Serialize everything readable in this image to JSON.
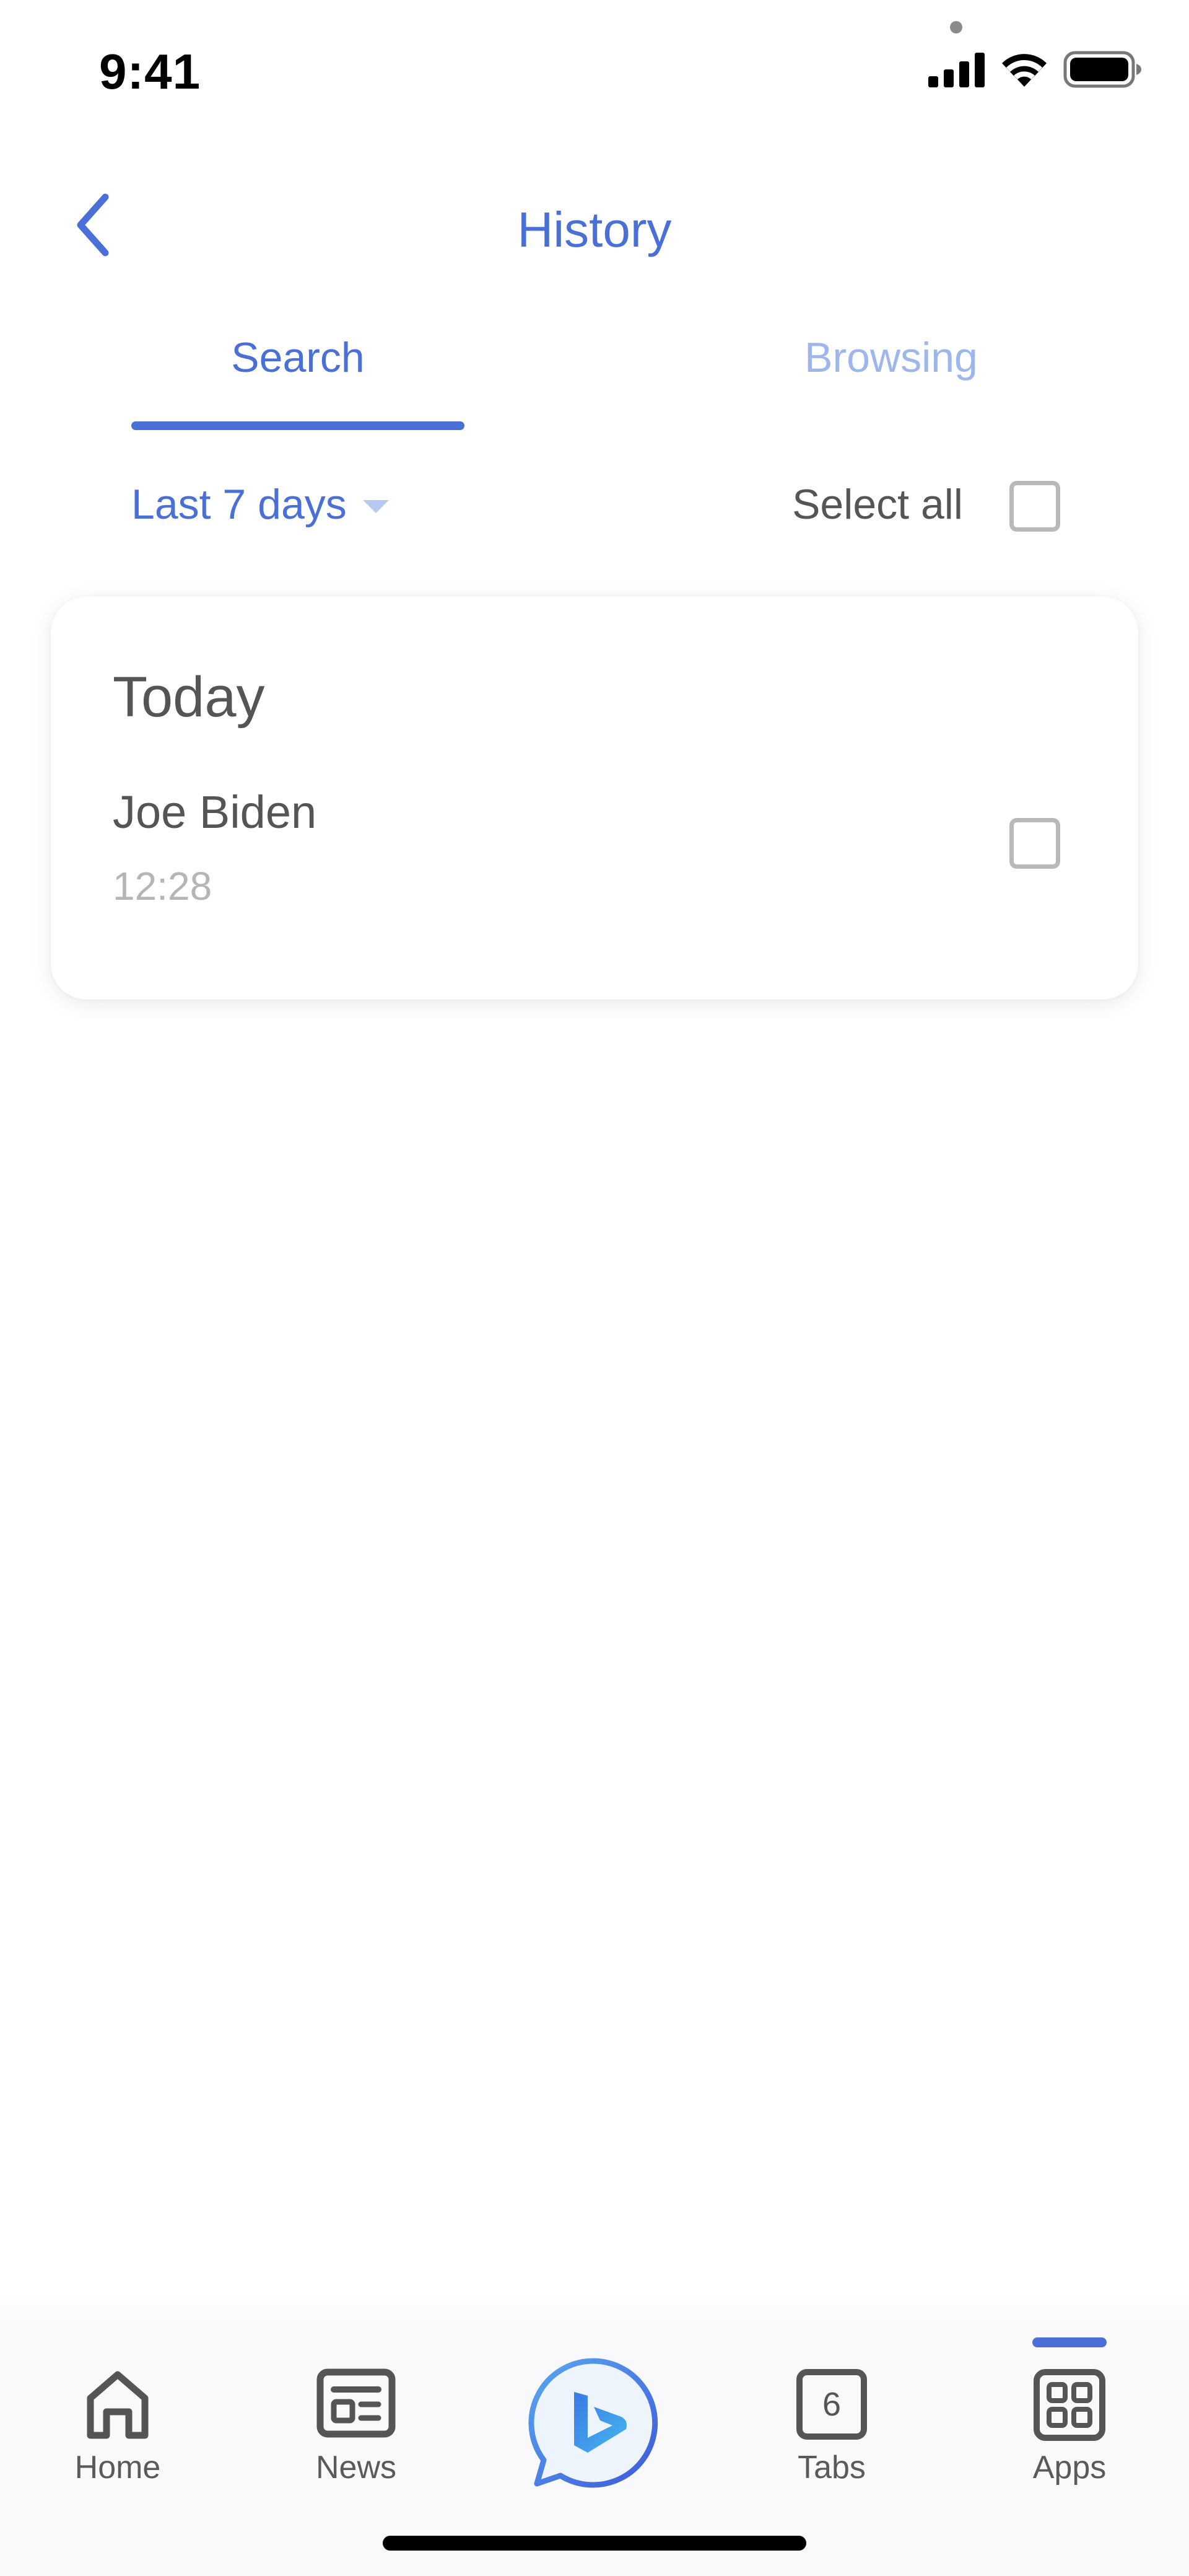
{
  "status_bar": {
    "time": "9:41",
    "icons": [
      "cellular-signal-icon",
      "wifi-icon",
      "battery-icon"
    ]
  },
  "header": {
    "title": "History",
    "back_icon": "chevron-left-icon"
  },
  "tabs": [
    {
      "label": "Search",
      "active": true
    },
    {
      "label": "Browsing",
      "active": false
    }
  ],
  "filter": {
    "label": "Last 7 days",
    "select_all_label": "Select all",
    "select_all_checked": false
  },
  "history": {
    "groups": [
      {
        "heading": "Today",
        "entries": [
          {
            "title": "Joe Biden",
            "time": "12:28",
            "checked": false
          }
        ]
      }
    ]
  },
  "bottom_nav": {
    "items": [
      {
        "label": "Home",
        "icon": "home-icon"
      },
      {
        "label": "News",
        "icon": "news-icon"
      },
      {
        "label": "",
        "icon": "bing-chat-icon"
      },
      {
        "label": "Tabs",
        "icon": "tabs-icon",
        "count": "6"
      },
      {
        "label": "Apps",
        "icon": "apps-grid-icon",
        "active": true
      }
    ]
  },
  "colors": {
    "accent": "#4a6fd6",
    "accent_light": "#9db6ec",
    "text_primary": "#555555",
    "text_secondary": "#b5b5b5"
  }
}
